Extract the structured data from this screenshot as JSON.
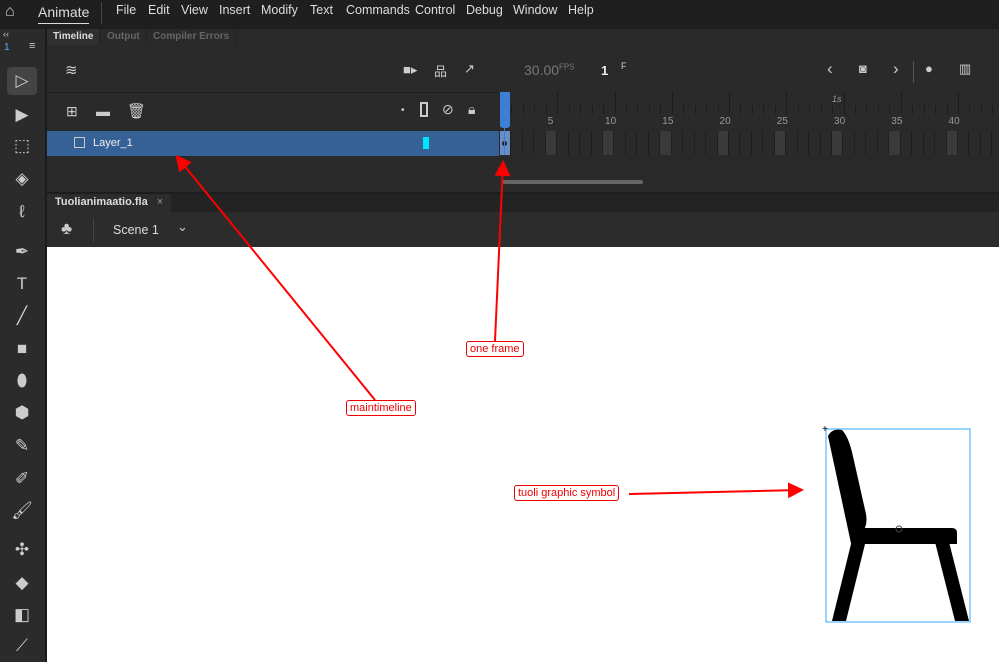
{
  "menubar": {
    "app_name": "Animate",
    "items": [
      "File",
      "Edit",
      "View",
      "Insert",
      "Modify",
      "Text",
      "Commands",
      "Control",
      "Debug",
      "Window",
      "Help"
    ]
  },
  "toolbar": {
    "collapse": "‹‹",
    "panel_num": "1",
    "tools": [
      "selection",
      "subselection",
      "free-transform",
      "3d-rotation",
      "lasso",
      "pen",
      "text",
      "line",
      "rectangle",
      "oval",
      "polystar",
      "pencil",
      "paint-brush",
      "brush",
      "bone",
      "paint-bucket",
      "ink-bottle",
      "eyedropper"
    ]
  },
  "panel_tabs": [
    "Timeline",
    "Output",
    "Compiler Errors"
  ],
  "timeline": {
    "fps": "30.00",
    "fps_unit": "FPS",
    "current_frame": "1",
    "frame_unit": "F",
    "second_marker": "1s",
    "frame_numbers": [
      "5",
      "10",
      "15",
      "20",
      "25",
      "30",
      "35",
      "40"
    ],
    "layers": [
      {
        "name": "Layer_1",
        "color": "#00e5ff",
        "selected": true
      }
    ],
    "frame_count": 1
  },
  "document": {
    "tab": "Tuolianimaatio.fla",
    "close": "×",
    "scene": "Scene 1"
  },
  "annotations": {
    "maintimeline": "maintimeline",
    "one_frame": "one frame",
    "symbol": "tuoli graphic symbol",
    "color": "#ff0000"
  }
}
